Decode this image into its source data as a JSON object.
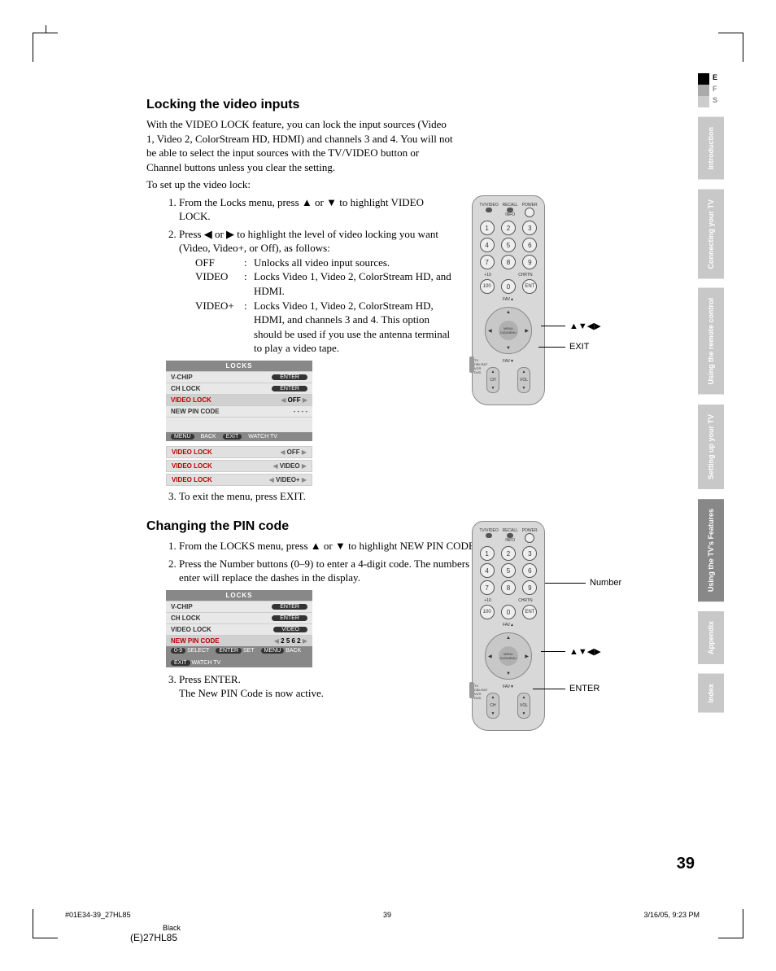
{
  "lang_tabs": [
    "E",
    "F",
    "S"
  ],
  "side_tabs": [
    "Introduction",
    "Connecting your TV",
    "Using the remote control",
    "Setting up your TV",
    "Using the TV's Features",
    "Appendix",
    "Index"
  ],
  "section1": {
    "heading": "Locking the video inputs",
    "para1": "With the VIDEO LOCK feature, you can lock the input sources (Video 1, Video 2, ColorStream HD, HDMI) and channels 3 and 4. You will not be able to select the input sources with the TV/VIDEO button or Channel buttons unless you clear the setting.",
    "para2": "To set up the video lock:",
    "step1": "From the Locks menu, press ▲ or ▼ to highlight VIDEO LOCK.",
    "step2": "Press ◀ or ▶ to highlight the level of video locking you want (Video, Video+, or Off), as follows:",
    "defs": [
      {
        "term": "OFF",
        "desc": "Unlocks all video input sources."
      },
      {
        "term": "VIDEO",
        "desc": "Locks Video 1, Video 2, ColorStream HD, and HDMI."
      },
      {
        "term": "VIDEO+",
        "desc": "Locks Video 1, Video 2, ColorStream HD, HDMI, and channels 3 and 4. This option should be used if you use the antenna terminal to play a video tape."
      }
    ],
    "step3": "To exit the menu, press EXIT.",
    "menu": {
      "title": "LOCKS",
      "rows": [
        {
          "label": "V-CHIP",
          "val": "ENTER",
          "pill": true
        },
        {
          "label": "CH LOCK",
          "val": "ENTER",
          "pill": true
        },
        {
          "label": "VIDEO LOCK",
          "val": "OFF",
          "sel": true,
          "arrows": true
        },
        {
          "label": "NEW PIN CODE",
          "val": "- - - -"
        }
      ],
      "footer_left": "MENU",
      "footer_l2": "BACK",
      "footer_r1": "EXIT",
      "footer_r2": "WATCH TV"
    },
    "small_rows": [
      {
        "label": "VIDEO LOCK",
        "val": "OFF"
      },
      {
        "label": "VIDEO LOCK",
        "val": "VIDEO"
      },
      {
        "label": "VIDEO LOCK",
        "val": "VIDEO+"
      }
    ]
  },
  "section2": {
    "heading": "Changing the PIN code",
    "step1": "From the LOCKS menu, press ▲ or ▼ to highlight NEW PIN CODE.",
    "step2": "Press the Number buttons (0–9) to enter a 4-digit code. The numbers you enter will replace the dashes in the display.",
    "step3a": "Press ENTER.",
    "step3b": "The New PIN Code is now active.",
    "menu": {
      "title": "LOCKS",
      "rows": [
        {
          "label": "V-CHIP",
          "val": "ENTER",
          "pill": true
        },
        {
          "label": "CH LOCK",
          "val": "ENTER",
          "pill": true
        },
        {
          "label": "VIDEO LOCK",
          "val": "VIDEO",
          "pill": true
        },
        {
          "label": "NEW PIN CODE",
          "val": "2 5 6 2",
          "sel": true,
          "arrows": true
        }
      ],
      "footer": [
        {
          "chip": "0-9",
          "txt": "SELECT"
        },
        {
          "chip": "ENTER",
          "txt": "SET"
        },
        {
          "chip": "MENU",
          "txt": "BACK"
        },
        {
          "chip": "EXIT",
          "txt": "WATCH TV"
        }
      ]
    }
  },
  "remote": {
    "top": [
      "TV/VIDEO",
      "RECALL",
      "POWER"
    ],
    "info": "INFO",
    "nums": [
      "1",
      "2",
      "3",
      "4",
      "5",
      "6",
      "7",
      "8",
      "9",
      "100",
      "0",
      "ENT"
    ],
    "sub": [
      "+10",
      "",
      "CHRTN"
    ],
    "ring_top": "FAV▲",
    "ring_bot": "FAV▼",
    "center": [
      "MENU",
      "DVDMENU"
    ],
    "rockers": [
      "CH",
      "VOL"
    ],
    "side": [
      "TV",
      "CBL/SAT",
      "VCR",
      "DVD"
    ]
  },
  "callouts1": {
    "arrows": "▲▼◀▶",
    "exit": "EXIT"
  },
  "callouts2": {
    "number": "Number",
    "arrows": "▲▼◀▶",
    "enter": "ENTER"
  },
  "page_num": "39",
  "footer": {
    "file": "#01E34-39_27HL85",
    "pg": "39",
    "date": "3/16/05, 9:23 PM",
    "black": "Black",
    "model": "(E)27HL85"
  }
}
